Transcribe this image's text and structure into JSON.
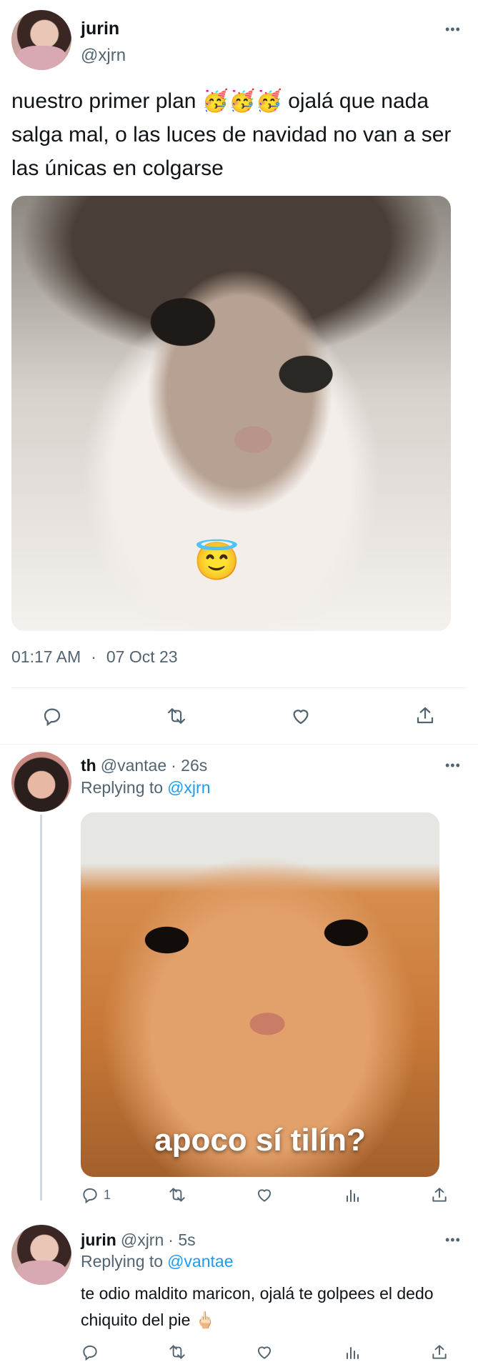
{
  "main_tweet": {
    "display_name": "jurin",
    "handle": "@xjrn",
    "text": "nuestro primer plan 🥳🥳🥳 ojalá que nada salga mal, o las luces de navidad no van a ser las únicas en colgarse",
    "image_emoji": "😇",
    "time": "01:17 AM",
    "separator": "·",
    "date": "07 Oct 23",
    "more_icon": "more-horizontal-icon",
    "actions": [
      "reply-icon",
      "retweet-icon",
      "like-icon",
      "share-icon"
    ]
  },
  "reply1": {
    "display_name": "th",
    "handle": "@vantae",
    "time": "· 26s",
    "replying_prefix": "Replying to",
    "replying_handle": "@xjrn",
    "image_caption": "apoco sí tilín?",
    "reply_count": "1",
    "actions": [
      "reply-icon",
      "retweet-icon",
      "like-icon",
      "views-icon",
      "share-icon"
    ]
  },
  "reply2": {
    "display_name": "jurin",
    "handle": "@xjrn",
    "time": "· 5s",
    "replying_prefix": "Replying to",
    "replying_handle": "@vantae",
    "text": "te odio maldito maricon, ojalá te golpees el dedo chiquito del pie 🖕🏻",
    "actions": [
      "reply-icon",
      "retweet-icon",
      "like-icon",
      "views-icon",
      "share-icon"
    ]
  },
  "colors": {
    "accent": "#1d9bf0",
    "muted": "#536471",
    "text": "#0f1419",
    "divider": "#eff3f4"
  }
}
